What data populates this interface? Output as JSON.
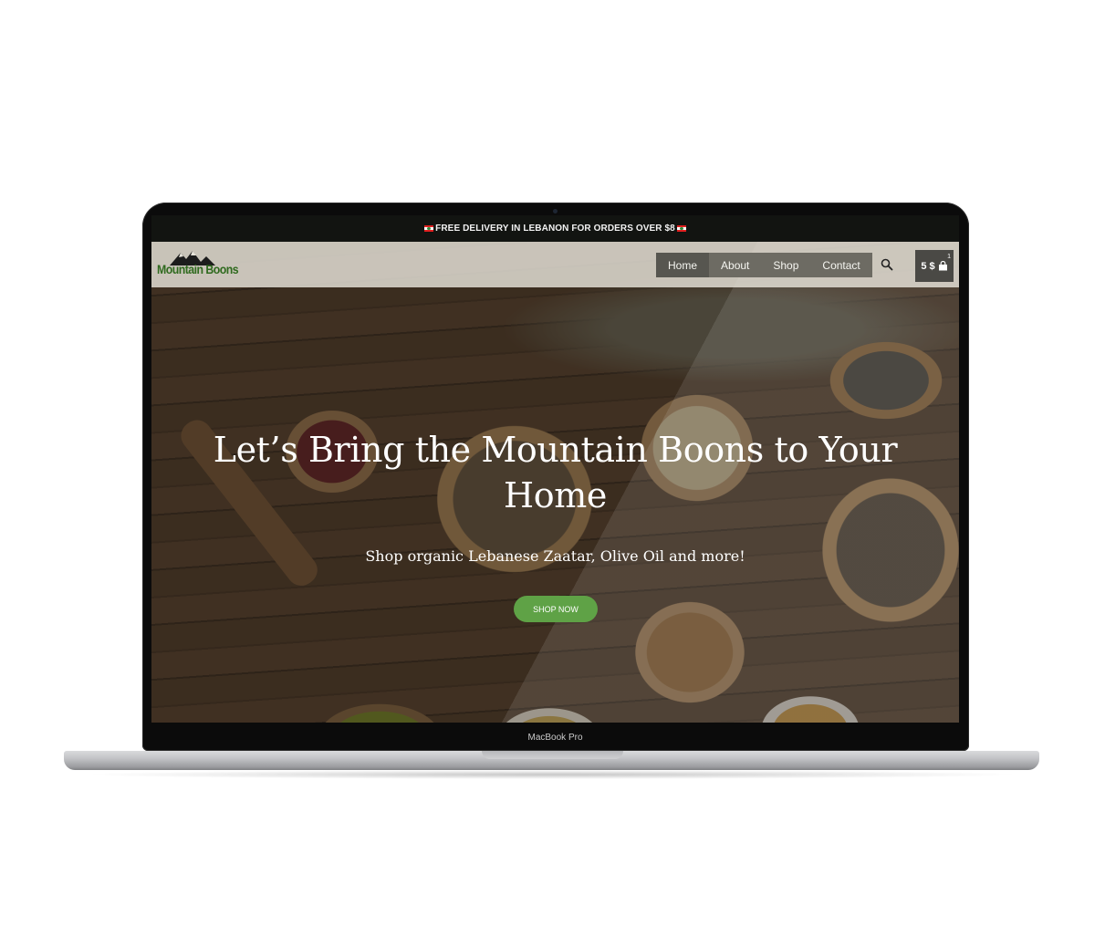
{
  "announcement": {
    "text": "FREE DELIVERY IN LEBANON FOR ORDERS OVER $8",
    "icon": "lebanon-flag-icon"
  },
  "header": {
    "logo_text": "Mountain Boons",
    "nav": [
      {
        "label": "Home",
        "active": true
      },
      {
        "label": "About",
        "active": false
      },
      {
        "label": "Shop",
        "active": false
      },
      {
        "label": "Contact",
        "active": false
      }
    ],
    "search_icon": "search-icon",
    "cart": {
      "total": "5 $",
      "count": "1",
      "icon": "shopping-bag-icon"
    }
  },
  "hero": {
    "headline": "Let’s Bring the Mountain Boons to Your Home",
    "subheadline": "Shop organic Lebanese Zaatar, Olive Oil and more!",
    "cta_label": "SHOP NOW"
  },
  "device": {
    "model_label": "MacBook Pro"
  },
  "colors": {
    "brand_green": "#2f6a1e",
    "cta_green": "#5fa246",
    "topbar": "#121411",
    "nav_bg": "#6d6b63"
  }
}
